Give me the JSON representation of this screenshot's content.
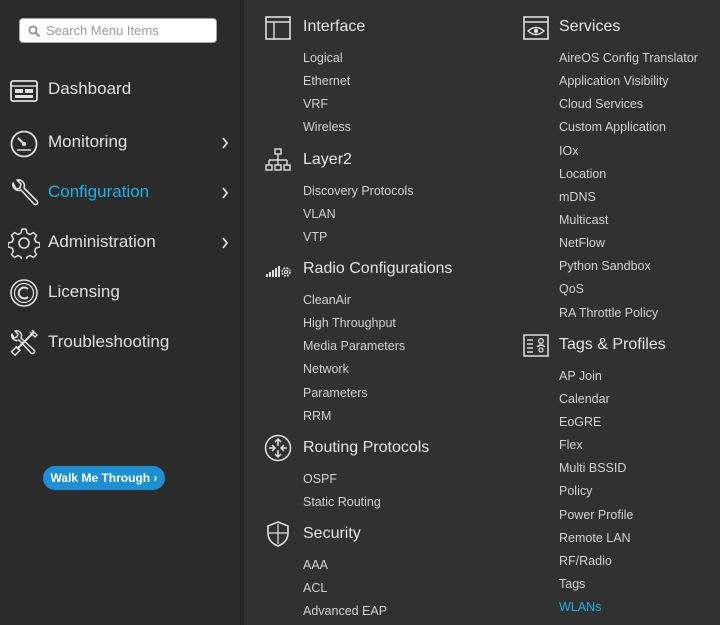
{
  "search": {
    "placeholder": "Search Menu Items"
  },
  "sidebar": {
    "items": [
      {
        "label": "Dashboard",
        "icon": "dashboard-icon",
        "has_submenu": false,
        "active": false
      },
      {
        "label": "Monitoring",
        "icon": "monitoring-gauge-icon",
        "has_submenu": true,
        "active": false
      },
      {
        "label": "Configuration",
        "icon": "configuration-wrench-icon",
        "has_submenu": true,
        "active": true
      },
      {
        "label": "Administration",
        "icon": "administration-gear-icon",
        "has_submenu": true,
        "active": false
      },
      {
        "label": "Licensing",
        "icon": "licensing-icon",
        "has_submenu": false,
        "active": false
      },
      {
        "label": "Troubleshooting",
        "icon": "troubleshooting-tools-icon",
        "has_submenu": false,
        "active": false
      }
    ],
    "walk_me_through": "Walk Me Through ›"
  },
  "menu": {
    "interface": {
      "title": "Interface",
      "icon": "interface-window-icon",
      "items": [
        "Logical",
        "Ethernet",
        "VRF",
        "Wireless"
      ]
    },
    "layer2": {
      "title": "Layer2",
      "icon": "layer2-topology-icon",
      "items": [
        "Discovery Protocols",
        "VLAN",
        "VTP"
      ]
    },
    "radio": {
      "title": "Radio Configurations",
      "icon": "radio-signal-gear-icon",
      "items": [
        "CleanAir",
        "High Throughput",
        "Media Parameters",
        "Network",
        "Parameters",
        "RRM"
      ]
    },
    "routing": {
      "title": "Routing Protocols",
      "icon": "routing-arrows-icon",
      "items": [
        "OSPF",
        "Static Routing"
      ]
    },
    "security": {
      "title": "Security",
      "icon": "security-shield-icon",
      "items": [
        "AAA",
        "ACL",
        "Advanced EAP"
      ]
    },
    "services": {
      "title": "Services",
      "icon": "services-eye-icon",
      "items": [
        "AireOS Config Translator",
        "Application Visibility",
        "Cloud Services",
        "Custom Application",
        "IOx",
        "Location",
        "mDNS",
        "Multicast",
        "NetFlow",
        "Python Sandbox",
        "QoS",
        "RA Throttle Policy"
      ]
    },
    "tags": {
      "title": "Tags & Profiles",
      "icon": "tags-profiles-icon",
      "items": [
        "AP Join",
        "Calendar",
        "EoGRE",
        "Flex",
        "Multi BSSID",
        "Policy",
        "Power Profile",
        "Remote LAN",
        "RF/Radio",
        "Tags",
        "WLANs"
      ],
      "active_item": "WLANs"
    }
  },
  "colors": {
    "accent": "#1ab2e8",
    "button": "#1e8fd3",
    "sidebar_bg": "#2b2b2b",
    "panel_bg": "#313131"
  }
}
